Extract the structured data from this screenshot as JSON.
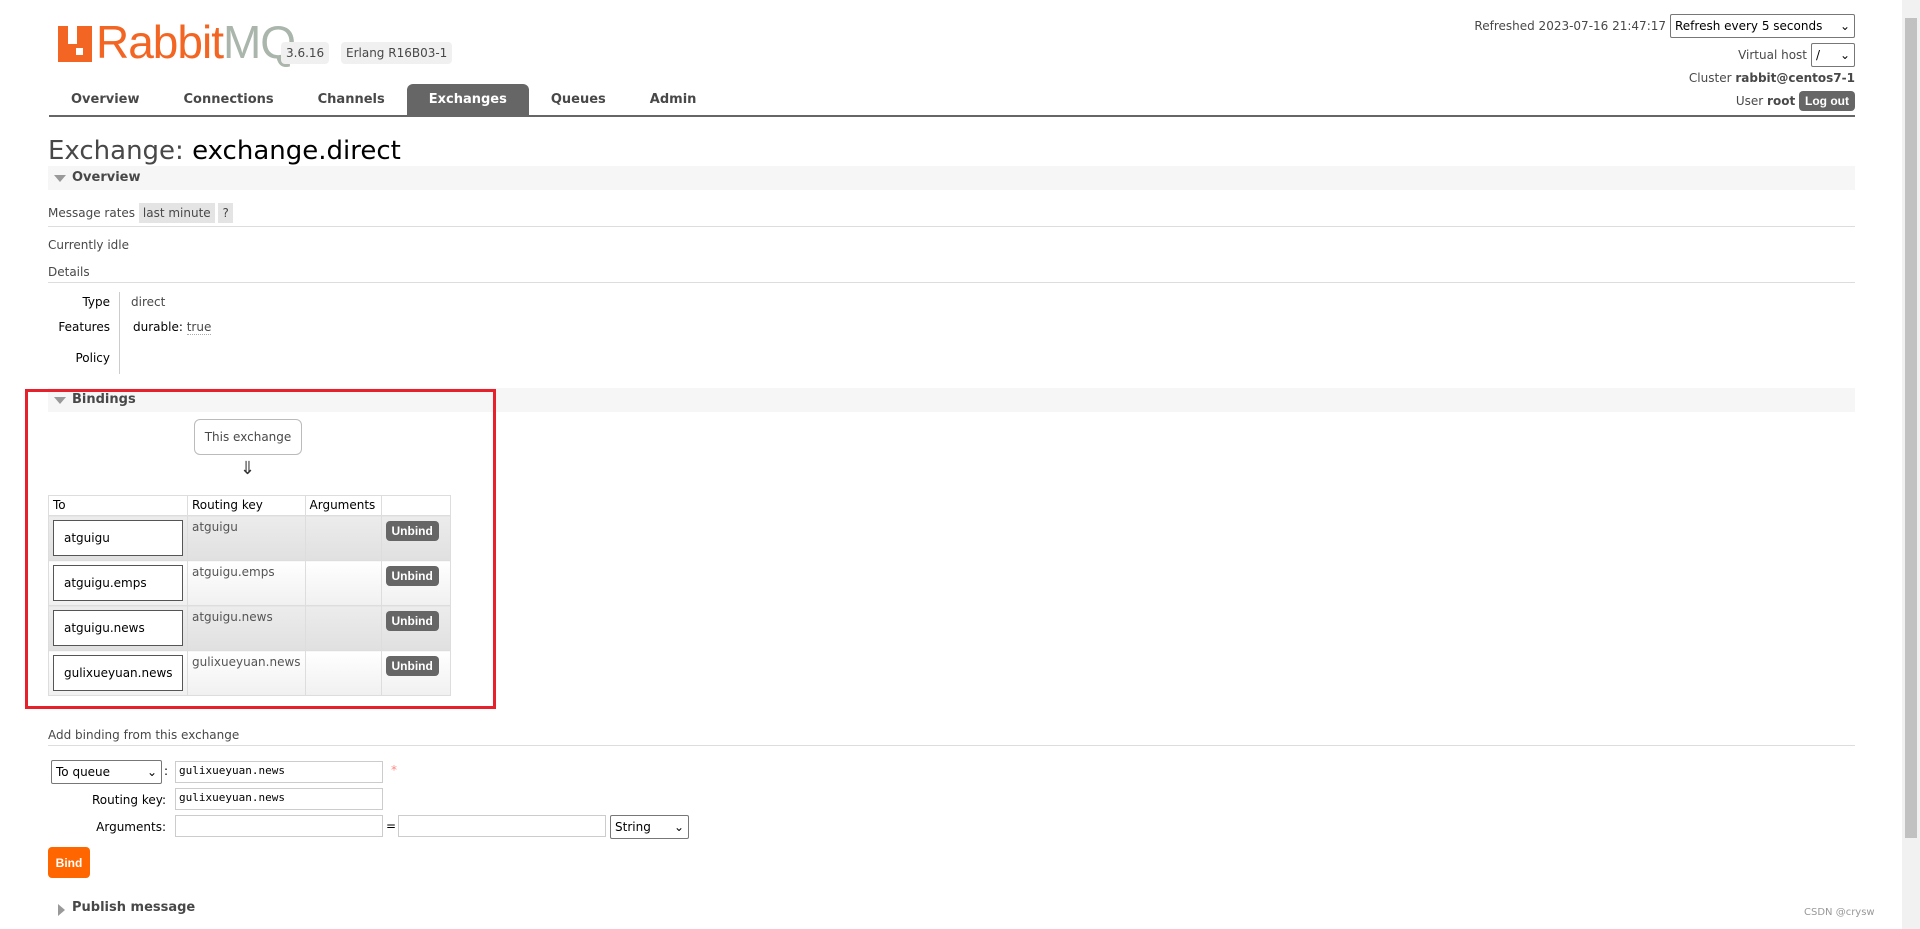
{
  "header": {
    "logo": "RabbitMQ",
    "version": "3.6.16",
    "erlang": "Erlang R16B03-1",
    "refreshed": "Refreshed 2023-07-16 21:47:17",
    "refresh_select": "Refresh every 5 seconds",
    "vhost_label": "Virtual host",
    "vhost_value": "/",
    "cluster_label": "Cluster",
    "cluster_value": "rabbit@centos7-1",
    "user_label": "User",
    "user_value": "root",
    "logout": "Log out"
  },
  "nav": {
    "tabs": [
      "Overview",
      "Connections",
      "Channels",
      "Exchanges",
      "Queues",
      "Admin"
    ],
    "active": "Exchanges"
  },
  "page": {
    "title_prefix": "Exchange:",
    "title_name": "exchange.direct"
  },
  "overview": {
    "section": "Overview",
    "message_rates": "Message rates",
    "rate_period": "last minute",
    "help": "?",
    "status": "Currently idle",
    "details": "Details",
    "type_label": "Type",
    "type_value": "direct",
    "features_label": "Features",
    "features_key": "durable:",
    "features_value": "true",
    "policy_label": "Policy"
  },
  "bindings": {
    "section": "Bindings",
    "this_exchange": "This exchange",
    "arrow": "⇓",
    "columns": [
      "To",
      "Routing key",
      "Arguments",
      ""
    ],
    "rows": [
      {
        "to": "atguigu",
        "routing_key": "atguigu",
        "arguments": "",
        "action": "Unbind"
      },
      {
        "to": "atguigu.emps",
        "routing_key": "atguigu.emps",
        "arguments": "",
        "action": "Unbind"
      },
      {
        "to": "atguigu.news",
        "routing_key": "atguigu.news",
        "arguments": "",
        "action": "Unbind"
      },
      {
        "to": "gulixueyuan.news",
        "routing_key": "gulixueyuan.news",
        "arguments": "",
        "action": "Unbind"
      }
    ]
  },
  "add_binding": {
    "title": "Add binding from this exchange",
    "dest_type": "To queue",
    "dest_value": "gulixueyuan.news",
    "required": "*",
    "routing_key_label": "Routing key:",
    "routing_key_value": "gulixueyuan.news",
    "arguments_label": "Arguments:",
    "equals": "=",
    "arg_type": "String",
    "bind": "Bind"
  },
  "publish": {
    "section": "Publish message"
  },
  "watermark": "CSDN @crysw",
  "colors": {
    "accent": "#f60",
    "logo_orange": "#f26522",
    "highlight_box": "#e6212b",
    "tab_active": "#666666"
  }
}
